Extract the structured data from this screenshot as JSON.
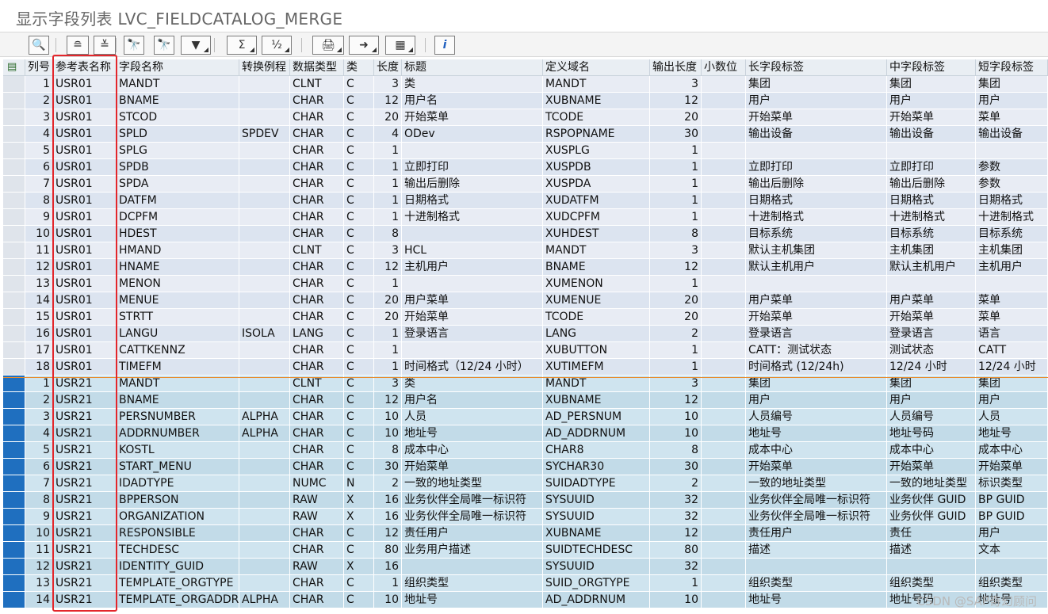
{
  "window": {
    "title": "显示字段列表 LVC_FIELDCATALOG_MERGE"
  },
  "toolbar": {
    "buttons": [
      {
        "name": "details-icon",
        "glyph": "🔍"
      },
      {
        "name": "sort-ascending-icon",
        "glyph": "≘"
      },
      {
        "name": "sort-descending-icon",
        "glyph": "≚"
      },
      {
        "name": "find-icon",
        "glyph": "🔭"
      },
      {
        "name": "find-next-icon",
        "glyph": "🔭"
      },
      {
        "name": "filter-icon",
        "glyph": "▼"
      },
      {
        "name": "sum-icon",
        "glyph": "Σ"
      },
      {
        "name": "subtotal-icon",
        "glyph": "½"
      },
      {
        "name": "print-preview-icon",
        "glyph": "🖨"
      },
      {
        "name": "export-icon",
        "glyph": "➜"
      },
      {
        "name": "layout-icon",
        "glyph": "▦"
      },
      {
        "name": "info-icon",
        "glyph": "i"
      }
    ]
  },
  "columns": [
    "列号",
    "参考表名称",
    "字段名称",
    "转换例程",
    "数据类型",
    "类",
    "长度",
    "标题",
    "定义域名",
    "输出长度",
    "小数位",
    "长字段标签",
    "中字段标签",
    "短字段标签"
  ],
  "rows": [
    [
      "1",
      "USR01",
      "MANDT",
      "",
      "CLNT",
      "C",
      "3",
      "类",
      "MANDT",
      "3",
      "",
      "集团",
      "集团",
      "集团"
    ],
    [
      "2",
      "USR01",
      "BNAME",
      "",
      "CHAR",
      "C",
      "12",
      "用户名",
      "XUBNAME",
      "12",
      "",
      "用户",
      "用户",
      "用户"
    ],
    [
      "3",
      "USR01",
      "STCOD",
      "",
      "CHAR",
      "C",
      "20",
      "开始菜单",
      "TCODE",
      "20",
      "",
      "开始菜单",
      "开始菜单",
      "菜单"
    ],
    [
      "4",
      "USR01",
      "SPLD",
      "SPDEV",
      "CHAR",
      "C",
      "4",
      "ODev",
      "RSPOPNAME",
      "30",
      "",
      "输出设备",
      "输出设备",
      "输出设备"
    ],
    [
      "5",
      "USR01",
      "SPLG",
      "",
      "CHAR",
      "C",
      "1",
      "",
      "XUSPLG",
      "1",
      "",
      "",
      "",
      ""
    ],
    [
      "6",
      "USR01",
      "SPDB",
      "",
      "CHAR",
      "C",
      "1",
      "立即打印",
      "XUSPDB",
      "1",
      "",
      "立即打印",
      "立即打印",
      "参数"
    ],
    [
      "7",
      "USR01",
      "SPDA",
      "",
      "CHAR",
      "C",
      "1",
      "输出后删除",
      "XUSPDA",
      "1",
      "",
      "输出后删除",
      "输出后删除",
      "参数"
    ],
    [
      "8",
      "USR01",
      "DATFM",
      "",
      "CHAR",
      "C",
      "1",
      "日期格式",
      "XUDATFM",
      "1",
      "",
      "日期格式",
      "日期格式",
      "日期格式"
    ],
    [
      "9",
      "USR01",
      "DCPFM",
      "",
      "CHAR",
      "C",
      "1",
      "十进制格式",
      "XUDCPFM",
      "1",
      "",
      "十进制格式",
      "十进制格式",
      "十进制格式"
    ],
    [
      "10",
      "USR01",
      "HDEST",
      "",
      "CHAR",
      "C",
      "8",
      "",
      "XUHDEST",
      "8",
      "",
      "目标系统",
      "目标系统",
      "目标系统"
    ],
    [
      "11",
      "USR01",
      "HMAND",
      "",
      "CLNT",
      "C",
      "3",
      "HCL",
      "MANDT",
      "3",
      "",
      "默认主机集团",
      "主机集团",
      "主机集团"
    ],
    [
      "12",
      "USR01",
      "HNAME",
      "",
      "CHAR",
      "C",
      "12",
      "主机用户",
      "BNAME",
      "12",
      "",
      "默认主机用户",
      "默认主机用户",
      "主机用户"
    ],
    [
      "13",
      "USR01",
      "MENON",
      "",
      "CHAR",
      "C",
      "1",
      "",
      "XUMENON",
      "1",
      "",
      "",
      "",
      ""
    ],
    [
      "14",
      "USR01",
      "MENUE",
      "",
      "CHAR",
      "C",
      "20",
      "用户菜单",
      "XUMENUE",
      "20",
      "",
      "用户菜单",
      "用户菜单",
      "菜单"
    ],
    [
      "15",
      "USR01",
      "STRTT",
      "",
      "CHAR",
      "C",
      "20",
      "开始菜单",
      "TCODE",
      "20",
      "",
      "开始菜单",
      "开始菜单",
      "菜单"
    ],
    [
      "16",
      "USR01",
      "LANGU",
      "ISOLA",
      "LANG",
      "C",
      "1",
      "登录语言",
      "LANG",
      "2",
      "",
      "登录语言",
      "登录语言",
      "语言"
    ],
    [
      "17",
      "USR01",
      "CATTKENNZ",
      "",
      "CHAR",
      "C",
      "1",
      "",
      "XUBUTTON",
      "1",
      "",
      "CATT：测试状态",
      "测试状态",
      "CATT"
    ],
    [
      "18",
      "USR01",
      "TIMEFM",
      "",
      "CHAR",
      "C",
      "1",
      "时间格式（12/24 小时）",
      "XUTIMEFM",
      "1",
      "",
      "时间格式 (12/24h)",
      "12/24 小时",
      "12/24 小时"
    ],
    [
      "1",
      "USR21",
      "MANDT",
      "",
      "CLNT",
      "C",
      "3",
      "类",
      "MANDT",
      "3",
      "",
      "集团",
      "集团",
      "集团"
    ],
    [
      "2",
      "USR21",
      "BNAME",
      "",
      "CHAR",
      "C",
      "12",
      "用户名",
      "XUBNAME",
      "12",
      "",
      "用户",
      "用户",
      "用户"
    ],
    [
      "3",
      "USR21",
      "PERSNUMBER",
      "ALPHA",
      "CHAR",
      "C",
      "10",
      "人员",
      "AD_PERSNUM",
      "10",
      "",
      "人员编号",
      "人员编号",
      "人员"
    ],
    [
      "4",
      "USR21",
      "ADDRNUMBER",
      "ALPHA",
      "CHAR",
      "C",
      "10",
      "地址号",
      "AD_ADDRNUM",
      "10",
      "",
      "地址号",
      "地址号码",
      "地址号"
    ],
    [
      "5",
      "USR21",
      "KOSTL",
      "",
      "CHAR",
      "C",
      "8",
      "成本中心",
      "CHAR8",
      "8",
      "",
      "成本中心",
      "成本中心",
      "成本中心"
    ],
    [
      "6",
      "USR21",
      "START_MENU",
      "",
      "CHAR",
      "C",
      "30",
      "开始菜单",
      "SYCHAR30",
      "30",
      "",
      "开始菜单",
      "开始菜单",
      "开始菜单"
    ],
    [
      "7",
      "USR21",
      "IDADTYPE",
      "",
      "NUMC",
      "N",
      "2",
      "一致的地址类型",
      "SUIDADTYPE",
      "2",
      "",
      "一致的地址类型",
      "一致的地址类型",
      "标识类型"
    ],
    [
      "8",
      "USR21",
      "BPPERSON",
      "",
      "RAW",
      "X",
      "16",
      "业务伙伴全局唯一标识符",
      "SYSUUID",
      "32",
      "",
      "业务伙伴全局唯一标识符",
      "业务伙伴 GUID",
      "BP GUID"
    ],
    [
      "9",
      "USR21",
      "ORGANIZATION",
      "",
      "RAW",
      "X",
      "16",
      "业务伙伴全局唯一标识符",
      "SYSUUID",
      "32",
      "",
      "业务伙伴全局唯一标识符",
      "业务伙伴 GUID",
      "BP GUID"
    ],
    [
      "10",
      "USR21",
      "RESPONSIBLE",
      "",
      "CHAR",
      "C",
      "12",
      "责任用户",
      "XUBNAME",
      "12",
      "",
      "责任用户",
      "责任",
      "用户"
    ],
    [
      "11",
      "USR21",
      "TECHDESC",
      "",
      "CHAR",
      "C",
      "80",
      "业务用户描述",
      "SUIDTECHDESC",
      "80",
      "",
      "描述",
      "描述",
      "文本"
    ],
    [
      "12",
      "USR21",
      "IDENTITY_GUID",
      "",
      "RAW",
      "X",
      "16",
      "",
      "SYSUUID",
      "32",
      "",
      "",
      "",
      ""
    ],
    [
      "13",
      "USR21",
      "TEMPLATE_ORGTYPE",
      "",
      "CHAR",
      "C",
      "1",
      "组织类型",
      "SUID_ORGTYPE",
      "1",
      "",
      "组织类型",
      "组织类型",
      "组织类型"
    ],
    [
      "14",
      "USR21",
      "TEMPLATE_ORGADDR",
      "ALPHA",
      "CHAR",
      "C",
      "10",
      "地址号",
      "AD_ADDRNUM",
      "10",
      "",
      "地址号",
      "地址号码",
      "地址号"
    ]
  ],
  "watermark": "CSDN @SAP奇幻顾问",
  "colors": {
    "accent_border": "#e3262b",
    "selected_row_marker": "#1f6fbf",
    "group_divider": "#e88c2e"
  }
}
